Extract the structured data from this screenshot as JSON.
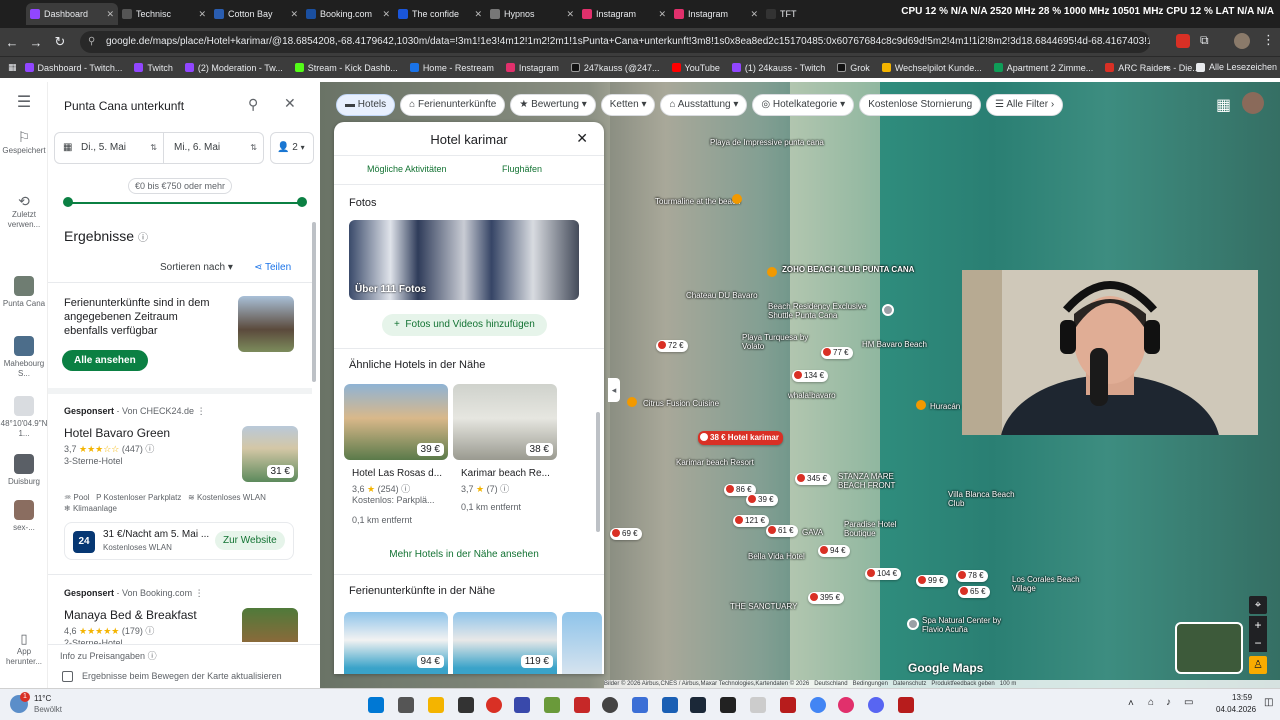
{
  "browser": {
    "tabs": [
      {
        "label": "Dashboard",
        "color": "#9146ff"
      },
      {
        "label": "Technisc",
        "color": "#202124"
      },
      {
        "label": "Cotton Bay",
        "color": "#2a5db0"
      },
      {
        "label": "Booking.com",
        "color": "#003580"
      },
      {
        "label": "The confide",
        "color": "#1a56db"
      },
      {
        "label": "Hypnos",
        "color": "#333"
      },
      {
        "label": "Instagram",
        "color": "#e1306c"
      },
      {
        "label": "Instagram",
        "color": "#e1306c"
      },
      {
        "label": "TFT",
        "color": "#111"
      }
    ],
    "system_status": "CPU 12 % N/A N/A 2520 MHz 28 % 1000 MHz 10501 MHz CPU 12 % LAT N/A N/A",
    "url": "google.de/maps/place/Hotel+karimar/@18.6854208,-68.4179642,1030m/data=!3m1!1e3!4m12!1m2!2m1!1sPunta+Cana+unterkunft!3m8!1s0x8ea8ed2c15170485:0x60767684c8c9d69d!5m2!4m1!1i2!8m2!3d18.6844695!4d-68.4167403!16s...",
    "bookmarks": [
      {
        "label": "Dashboard - Twitch...",
        "color": "#9146ff"
      },
      {
        "label": "Twitch",
        "color": "#9146ff"
      },
      {
        "label": "(2) Moderation - Tw...",
        "color": "#9146ff"
      },
      {
        "label": "Stream - Kick Dashb...",
        "color": "#53fc18"
      },
      {
        "label": "Home - Restream",
        "color": "#1a73e8"
      },
      {
        "label": "Instagram",
        "color": "#e1306c"
      },
      {
        "label": "247kauss (@247...",
        "color": "#111"
      },
      {
        "label": "YouTube",
        "color": "#ff0000"
      },
      {
        "label": "(1) 24kauss - Twitch",
        "color": "#9146ff"
      },
      {
        "label": "Grok",
        "color": "#111"
      },
      {
        "label": "Wechselpilot Kunde...",
        "color": "#f4b400"
      },
      {
        "label": "Apartment 2 Zimme...",
        "color": "#0f9d58"
      },
      {
        "label": "ARC Raiders - Die...",
        "color": "#d93025"
      }
    ],
    "all_bookmarks": "Alle Lesezeichen"
  },
  "rail": {
    "items": [
      {
        "label": "Gespeichert"
      },
      {
        "label": "Zuletzt verwen..."
      },
      {
        "label": "Punta Cana"
      },
      {
        "label": "Mahebourg S..."
      },
      {
        "label": "48°10'04.9\"N 1..."
      },
      {
        "label": "Duisburg"
      },
      {
        "label": "sex-..."
      }
    ],
    "app": "App herunter..."
  },
  "search": {
    "query": "Punta Cana unterkunft"
  },
  "dates": {
    "checkin": "Di., 5. Mai",
    "checkout": "Mi., 6. Mai",
    "guests": "2"
  },
  "price": {
    "label": "€0 bis €750 oder mehr"
  },
  "results": {
    "heading": "Ergebnisse",
    "sort": "Sortieren nach",
    "share": "Teilen",
    "promo_text": "Ferienunterkünfte sind in dem angegebenen Zeitraum ebenfalls verfügbar",
    "promo_button": "Alle ansehen",
    "hotel1": {
      "sponsored": "Gesponsert",
      "via": "Von CHECK24.de",
      "name": "Hotel Bavaro Green",
      "rating": "3,7",
      "stars": "★★★☆☆",
      "reviews": "(447)",
      "class": "3-Sterne-Hotel",
      "price": "31 €",
      "amenities": [
        "Pool",
        "Kostenloser Parkplatz",
        "Kostenloses WLAN",
        "Klimaanlage"
      ],
      "offer": "31 €/Nacht am 5. Mai ...",
      "offer_sub": "Kostenloses WLAN",
      "offer_button": "Zur Website"
    },
    "hotel2": {
      "sponsored": "Gesponsert",
      "via": "Von Booking.com",
      "name": "Manaya Bed & Breakfast",
      "rating": "4,6",
      "stars": "★★★★★",
      "reviews": "(179)",
      "class": "2-Sterne-Hotel"
    },
    "price_info": "Info zu Preisangaben",
    "update_checkbox": "Ergebnisse beim Bewegen der Karte aktualisieren"
  },
  "filters": [
    "Hotels",
    "Ferienunterkünfte",
    "Bewertung",
    "Ketten",
    "Ausstattung",
    "Hotelkategorie",
    "Kostenlose Stornierung",
    "Alle Filter"
  ],
  "detail": {
    "title": "Hotel karimar",
    "links": [
      "Mögliche Aktivitäten",
      "Flughäfen"
    ],
    "photos_heading": "Fotos",
    "photos_count": "Über 111 Fotos",
    "add_photos": "Fotos und Videos hinzufügen",
    "similar_heading": "Ähnliche Hotels in der Nähe",
    "similar": [
      {
        "price": "39 €",
        "name": "Hotel Las Rosas d...",
        "rating": "3,6",
        "reviews": "(254)",
        "extra": "Kostenlos: Parkplä...",
        "distance": "0,1 km entfernt"
      },
      {
        "price": "38 €",
        "name": "Karimar beach Re...",
        "rating": "3,7",
        "reviews": "(7)",
        "extra": "",
        "distance": "0,1 km entfernt"
      }
    ],
    "more_hotels": "Mehr Hotels in der Nähe ansehen",
    "vacation_heading": "Ferienunterkünfte in der Nähe",
    "vacation_prices": [
      "94 €",
      "119 €"
    ]
  },
  "map": {
    "pins": [
      "72 €",
      "77 €",
      "134 €",
      "38 € Hotel karimar",
      "345 €",
      "86 €",
      "39 €",
      "121 €",
      "61 €",
      "94 €",
      "104 €",
      "99 €",
      "78 €",
      "65 €",
      "395 €",
      "69 €"
    ],
    "labels": [
      "Playa de Impressive punta cana",
      "Tourmaline at the beach",
      "ZOHO BEACH CLUB PUNTA CANA",
      "Beach Residency Exclusive Shuttle Punta Cana",
      "Chateau DU Bavaro",
      "Playa Turquesa by Volato",
      "HM Bavaro Beach",
      "Citrus Fusion Cuisine",
      "whala!bavaro",
      "STANZA MARE BEACH FRONT",
      "Karimar beach Resort",
      "Paradise Hotel Boutique",
      "Bella Vida Hotel",
      "Villa Blanca Beach Club",
      "Los Corales Beach Village",
      "THE SANCTUARY",
      "Spa Natural Center by Flavio Acuña",
      "Huracán",
      "GAVA"
    ],
    "attribution": "Bilder © 2026 Airbus,CNES / Airbus,Maxar Technologies,Kartendaten © 2026",
    "footer_links": [
      "Deutschland",
      "Bedingungen",
      "Datenschutz",
      "Produktfeedback geben",
      "100 m"
    ],
    "brand": "Google Maps"
  },
  "taskbar": {
    "weather_temp": "11°C",
    "weather_text": "Bewölkt",
    "time": "13:59",
    "date": "04.04.2026"
  }
}
